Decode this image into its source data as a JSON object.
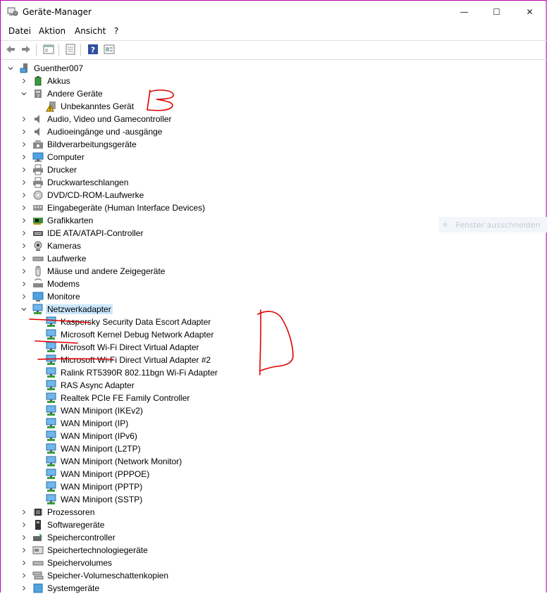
{
  "window": {
    "title": "Geräte-Manager",
    "controls": {
      "minimize": "—",
      "maximize": "☐",
      "close": "✕"
    }
  },
  "menu": [
    "Datei",
    "Aktion",
    "Ansicht",
    "?"
  ],
  "toolbar": [
    "back-icon",
    "forward-icon",
    "tree-view-icon",
    "properties-icon",
    "help-icon",
    "device-view-icon"
  ],
  "tree": {
    "root": "Guenther007",
    "items": [
      {
        "label": "Akkus",
        "icon": "battery-icon",
        "expanded": false
      },
      {
        "label": "Andere Geräte",
        "icon": "other-devices-icon",
        "expanded": true,
        "children": [
          "Unbekanntes Gerät"
        ]
      },
      {
        "label": "Audio, Video und Gamecontroller",
        "icon": "speaker-icon",
        "expanded": false
      },
      {
        "label": "Audioeingänge und -ausgänge",
        "icon": "speaker-icon",
        "expanded": false
      },
      {
        "label": "Bildverarbeitungsgeräte",
        "icon": "camera-device-icon",
        "expanded": false
      },
      {
        "label": "Computer",
        "icon": "computer-icon",
        "expanded": false
      },
      {
        "label": "Drucker",
        "icon": "printer-icon",
        "expanded": false
      },
      {
        "label": "Druckwarteschlangen",
        "icon": "printer-icon",
        "expanded": false
      },
      {
        "label": "DVD/CD-ROM-Laufwerke",
        "icon": "disc-icon",
        "expanded": false
      },
      {
        "label": "Eingabegeräte (Human Interface Devices)",
        "icon": "hid-icon",
        "expanded": false
      },
      {
        "label": "Grafikkarten",
        "icon": "gpu-icon",
        "expanded": false
      },
      {
        "label": "IDE ATA/ATAPI-Controller",
        "icon": "ide-icon",
        "expanded": false
      },
      {
        "label": "Kameras",
        "icon": "webcam-icon",
        "expanded": false
      },
      {
        "label": "Laufwerke",
        "icon": "drive-icon",
        "expanded": false
      },
      {
        "label": "Mäuse und andere Zeigegeräte",
        "icon": "mouse-icon",
        "expanded": false
      },
      {
        "label": "Modems",
        "icon": "modem-icon",
        "expanded": false
      },
      {
        "label": "Monitore",
        "icon": "monitor-icon",
        "expanded": false
      },
      {
        "label": "Netzwerkadapter",
        "icon": "network-adapter-icon",
        "expanded": true,
        "selected": true,
        "children": [
          "Kaspersky Security Data Escort Adapter",
          "Microsoft Kernel Debug Network Adapter",
          "Microsoft Wi-Fi Direct Virtual Adapter",
          "Microsoft Wi-Fi Direct Virtual Adapter #2",
          "Ralink RT5390R 802.11bgn Wi-Fi Adapter",
          "RAS Async Adapter",
          "Realtek PCIe FE Family Controller",
          "WAN Miniport (IKEv2)",
          "WAN Miniport (IP)",
          "WAN Miniport (IPv6)",
          "WAN Miniport (L2TP)",
          "WAN Miniport (Network Monitor)",
          "WAN Miniport (PPPOE)",
          "WAN Miniport (PPTP)",
          "WAN Miniport (SSTP)"
        ]
      },
      {
        "label": "Prozessoren",
        "icon": "cpu-icon",
        "expanded": false
      },
      {
        "label": "Softwaregeräte",
        "icon": "software-device-icon",
        "expanded": false
      },
      {
        "label": "Speichercontroller",
        "icon": "storage-controller-icon",
        "expanded": false
      },
      {
        "label": "Speichertechnologiegeräte",
        "icon": "storage-tech-icon",
        "expanded": false
      },
      {
        "label": "Speichervolumes",
        "icon": "volume-icon",
        "expanded": false
      },
      {
        "label": "Speicher-Volumeschattenkopien",
        "icon": "shadow-copy-icon",
        "expanded": false
      },
      {
        "label": "Systemgeräte",
        "icon": "system-device-icon",
        "expanded": false
      }
    ]
  },
  "ghost_tooltip": "Fenster ausschneiden",
  "colors": {
    "selection": "#cce8ff",
    "annotation": "#e00000",
    "window_border": "#b300b3"
  }
}
